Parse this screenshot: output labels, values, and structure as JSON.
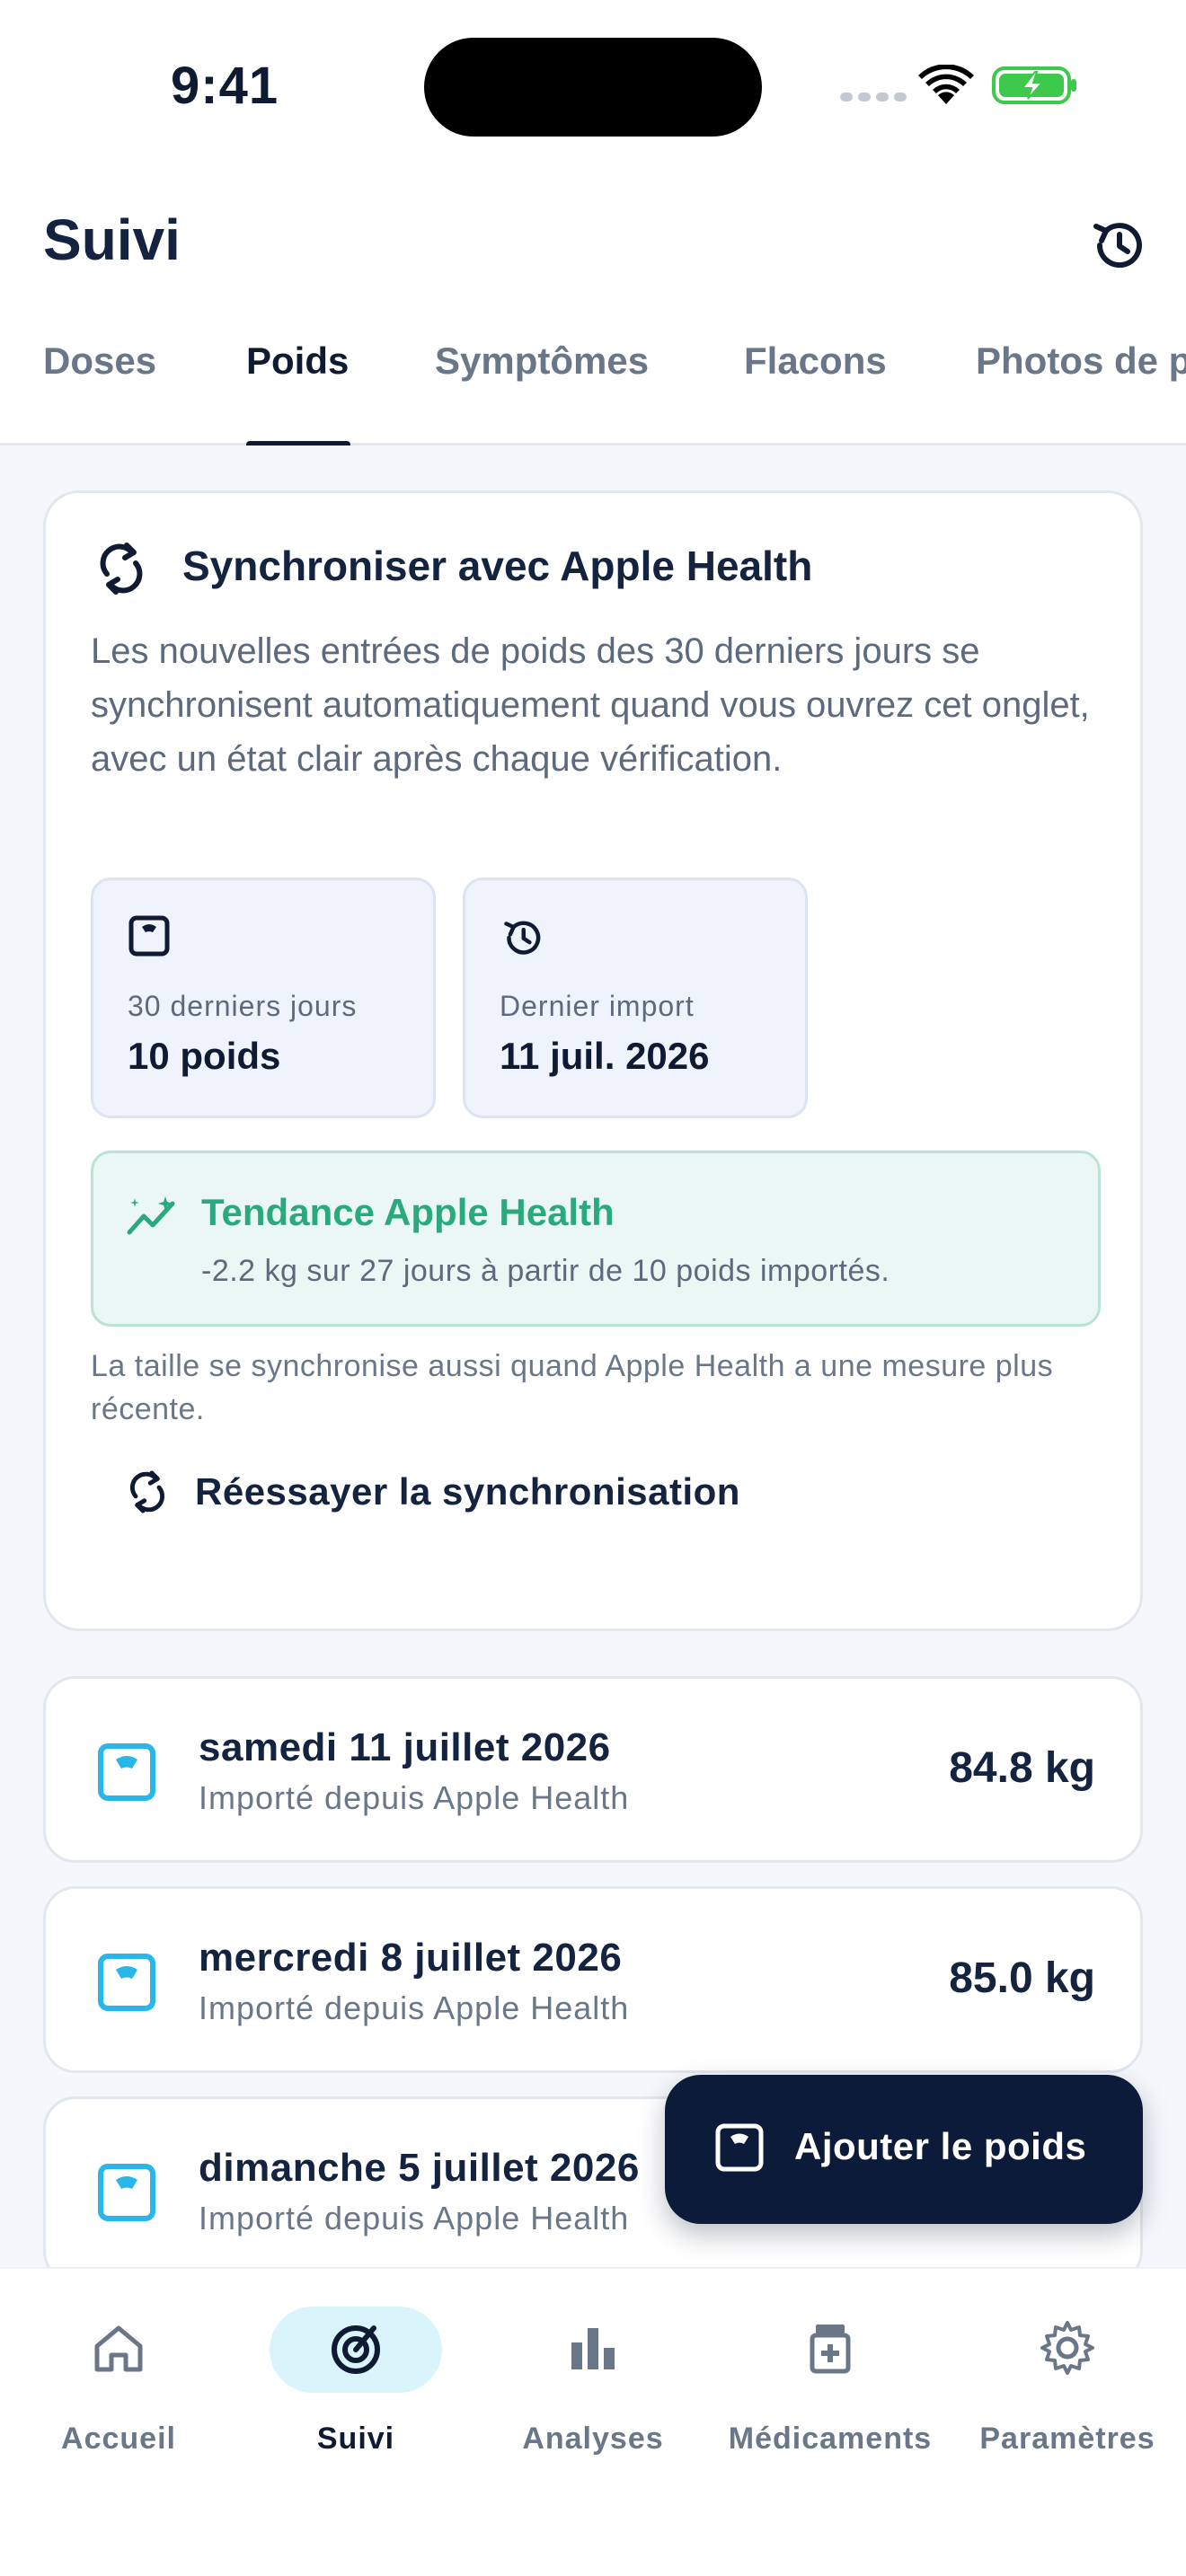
{
  "status_bar": {
    "time": "9:41"
  },
  "header": {
    "title": "Suivi",
    "tabs": [
      {
        "label": "Doses"
      },
      {
        "label": "Poids"
      },
      {
        "label": "Symptômes"
      },
      {
        "label": "Flacons"
      },
      {
        "label": "Photos de p"
      }
    ],
    "active_tab": "Poids"
  },
  "sync_card": {
    "title": "Synchroniser avec Apple Health",
    "description": "Les nouvelles entrées de poids des 30 derniers jours se synchronisent automatiquement quand vous ouvrez cet onglet, avec un état clair après chaque vérification.",
    "stats": [
      {
        "label": "30 derniers jours",
        "value": "10 poids",
        "icon": "scale-icon"
      },
      {
        "label": "Dernier import",
        "value": "11 juil. 2026",
        "icon": "history-icon"
      }
    ],
    "trend": {
      "title": "Tendance Apple Health",
      "description": "-2.2 kg sur 27 jours à partir de 10 poids importés."
    },
    "height_note": "La taille se synchronise aussi quand Apple Health a une mesure plus récente.",
    "retry_label": "Réessayer la synchronisation"
  },
  "weights": [
    {
      "date": "samedi 11 juillet 2026",
      "source": "Importé depuis Apple Health",
      "value": "84.8 kg"
    },
    {
      "date": "mercredi 8 juillet 2026",
      "source": "Importé depuis Apple Health",
      "value": "85.0 kg"
    },
    {
      "date": "dimanche 5 juillet 2026",
      "source": "Importé depuis Apple Health",
      "value": ""
    }
  ],
  "fab": {
    "label": "Ajouter le poids"
  },
  "bottom_nav": [
    {
      "label": "Accueil",
      "icon": "home-icon"
    },
    {
      "label": "Suivi",
      "icon": "tracking-icon"
    },
    {
      "label": "Analyses",
      "icon": "bar-chart-icon"
    },
    {
      "label": "Médicaments",
      "icon": "medication-icon"
    },
    {
      "label": "Paramètres",
      "icon": "gear-icon"
    }
  ],
  "active_nav": "Suivi",
  "colors": {
    "navy": "#0f1b33",
    "trend_green": "#2aa97e",
    "scale_blue": "#29b6e8",
    "nav_pill": "#d9f4fb",
    "battery_green": "#3cc94c"
  }
}
